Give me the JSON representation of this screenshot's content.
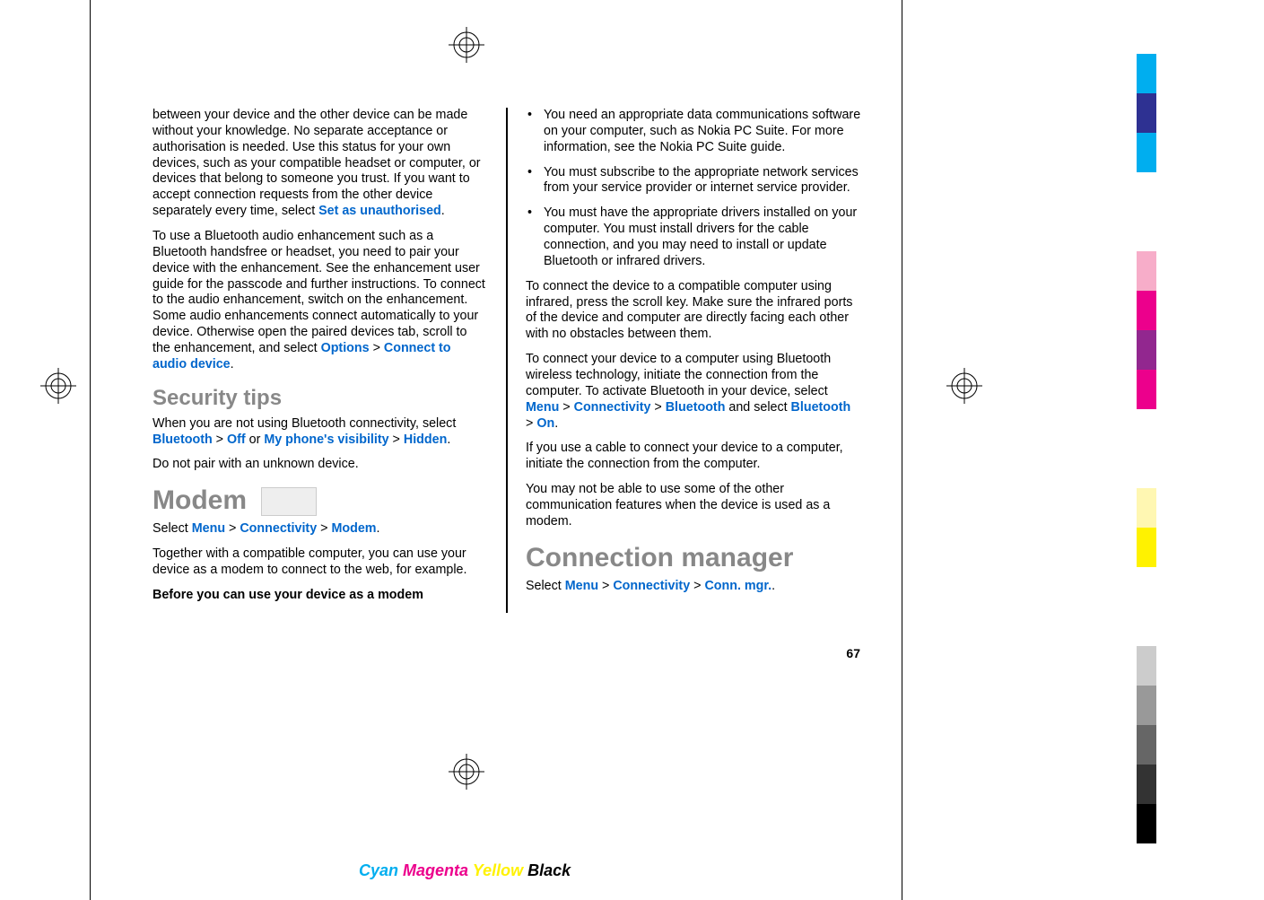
{
  "col1": {
    "p1a": "between your device and the other device can be made without your knowledge. No separate acceptance or authorisation is needed. Use this status for your own devices, such as your compatible headset or computer, or devices that belong to someone you trust. If you want to accept connection requests from the other device separately every time, select ",
    "p1b": "Set as unauthorised",
    "p1c": ".",
    "p2a": "To use a Bluetooth audio enhancement such as a Bluetooth handsfree or headset, you need to pair your device with the enhancement. See the enhancement user guide for the passcode and further instructions. To connect to the audio enhancement, switch on the enhancement. Some audio enhancements connect automatically to your device. Otherwise open the paired devices tab, scroll to the enhancement, and select ",
    "p2b": "Options",
    "p2c": "Connect to audio device",
    "h2_security": "Security tips",
    "p3a": "When you are not using Bluetooth connectivity, select ",
    "p3b": "Bluetooth",
    "p3c": "Off",
    "p3d": " or ",
    "p3e": "My phone's visibility",
    "p3f": "Hidden",
    "p4": "Do not pair with an unknown device.",
    "h1_modem": "Modem",
    "p5a": "Select ",
    "p5b": "Menu",
    "p5c": "Connectivity",
    "p5d": "Modem",
    "p6": "Together with a compatible computer, you can use your device as a modem to connect to the web, for example.",
    "p7": "Before you can use your device as a modem"
  },
  "col2": {
    "li1": "You need an appropriate data communications software on your computer, such as Nokia PC Suite. For more information, see the Nokia PC Suite guide.",
    "li2": "You must subscribe to the appropriate network services from your service provider or internet service provider.",
    "li3": "You must have the appropriate drivers installed on your computer. You must install drivers for the cable connection, and you may need to install or update Bluetooth or infrared drivers.",
    "p1": "To connect the device to a compatible computer using infrared, press the scroll key. Make sure the infrared ports of the device and computer are directly facing each other with no obstacles between them.",
    "p2a": "To connect your device to a computer using Bluetooth wireless technology, initiate the connection from the computer. To activate Bluetooth in your device, select ",
    "p2b": "Menu",
    "p2c": "Connectivity",
    "p2d": "Bluetooth",
    "p2e": " and select ",
    "p2f": "Bluetooth",
    "p2g": "On",
    "p3": "If you use a cable to connect your device to a computer, initiate the connection from the computer.",
    "p4": "You may not be able to use some of the other communication features when the device is used as a modem.",
    "h1_conn": "Connection manager",
    "p5a": "Select ",
    "p5b": "Menu",
    "p5c": "Connectivity",
    "p5d": "Conn. mgr.",
    "p5e": "."
  },
  "page_number": "67",
  "colors": {
    "cyan": "Cyan",
    "magenta": "Magenta",
    "yellow": "Yellow",
    "black": "Black"
  },
  "gt": " > "
}
